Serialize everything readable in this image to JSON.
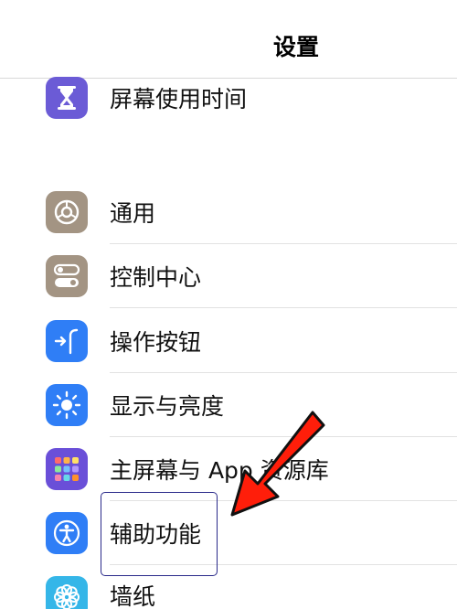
{
  "header": {
    "title": "设置"
  },
  "settings": [
    {
      "label": "屏幕使用时间",
      "icon": "hourglass-icon",
      "color": "#6b5bd6"
    },
    {
      "label": "通用",
      "icon": "gear-icon",
      "color": "#a39483"
    },
    {
      "label": "控制中心",
      "icon": "toggles-icon",
      "color": "#a39483"
    },
    {
      "label": "操作按钮",
      "icon": "action-button-icon",
      "color": "#2f7ef6"
    },
    {
      "label": "显示与亮度",
      "icon": "sun-icon",
      "color": "#2f7ef6"
    },
    {
      "label": "主屏幕与 App 资源库",
      "icon": "app-grid-icon",
      "color": "#6a4fd8"
    },
    {
      "label": "辅助功能",
      "icon": "accessibility-icon",
      "color": "#2f7ef6"
    },
    {
      "label": "墙纸",
      "icon": "flower-icon",
      "color": "#35b6e8"
    }
  ],
  "annotation": {
    "arrow_color": "#ff1e0a",
    "box_color": "#2a2a8a"
  }
}
